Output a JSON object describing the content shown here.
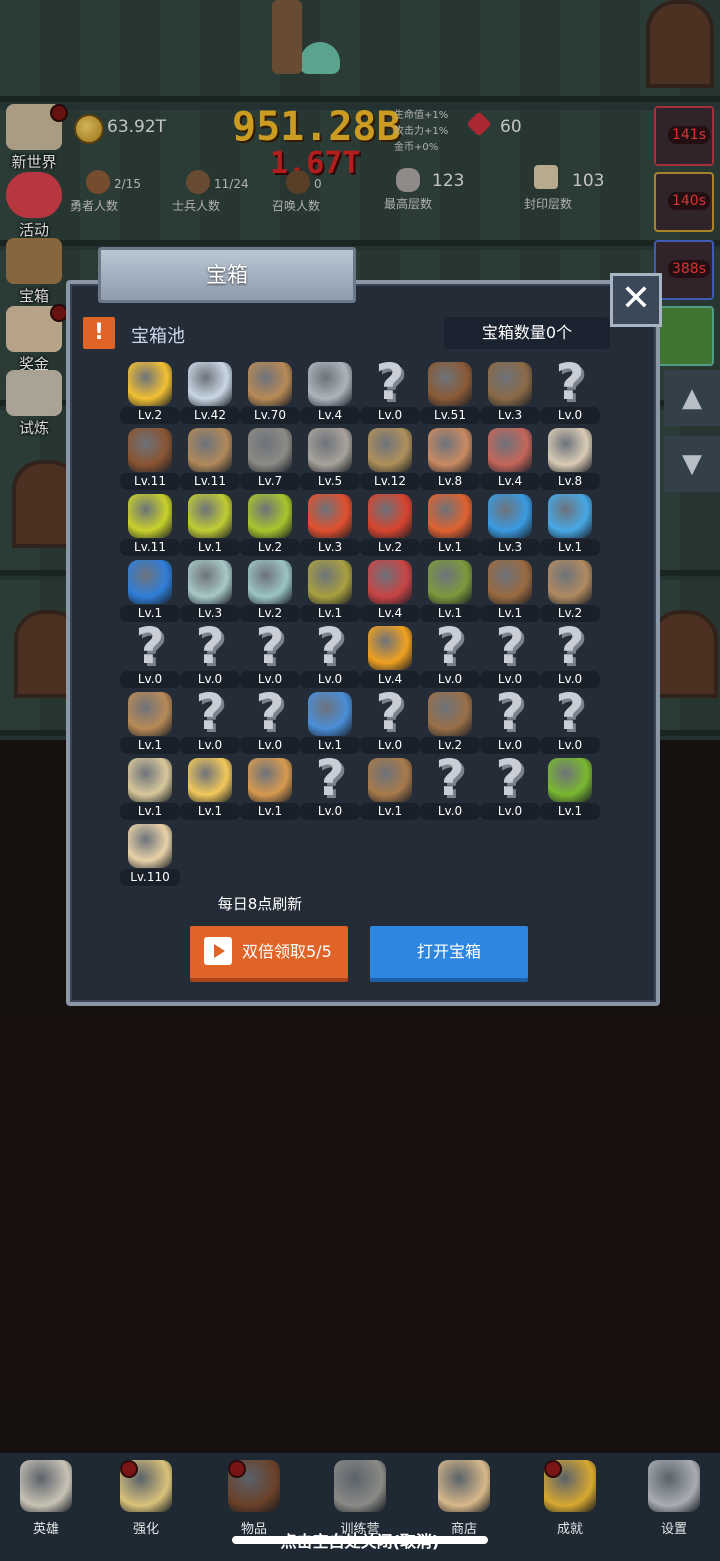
{
  "hud": {
    "gold": "63.92T",
    "gems": "60",
    "buffs": [
      "生命值+1%",
      "攻击力+1%",
      "金币+0%"
    ],
    "damage_main": "951.28B",
    "damage_sub": "1.67T",
    "stats": [
      {
        "value": "2/15",
        "label": "勇者人数"
      },
      {
        "value": "11/24",
        "label": "士兵人数"
      },
      {
        "value": "0",
        "label": "召唤人数"
      },
      {
        "value": "123",
        "label": "最高层数"
      },
      {
        "value": "103",
        "label": "封印层数"
      }
    ]
  },
  "sidebar": {
    "items": [
      {
        "label": "新世界"
      },
      {
        "label": "活动"
      },
      {
        "label": "宝箱"
      },
      {
        "label": "奖金"
      },
      {
        "label": "试炼"
      }
    ]
  },
  "timers": [
    "141s",
    "140s",
    "388s"
  ],
  "modal": {
    "title": "宝箱",
    "pool_label": "宝箱池",
    "warn_glyph": "!",
    "close_glyph": "✕",
    "chest_count": "宝箱数量0个",
    "refresh_text": "每日8点刷新",
    "double_button": "双倍领取5/5",
    "open_button": "打开宝箱",
    "items": [
      {
        "icon": "crown-icon",
        "lv": "Lv.2",
        "color": "#f2c033"
      },
      {
        "icon": "diamond-icon",
        "lv": "Lv.42",
        "color": "#c9d7e4"
      },
      {
        "icon": "wooden-sword-icon",
        "lv": "Lv.70",
        "color": "#b88a56"
      },
      {
        "icon": "steel-sword-icon",
        "lv": "Lv.4",
        "color": "#aeb4bc"
      },
      {
        "icon": "unknown-icon",
        "lv": "Lv.0",
        "color": "#c9ced6"
      },
      {
        "icon": "leather-armor-icon",
        "lv": "Lv.51",
        "color": "#8a5a36"
      },
      {
        "icon": "backpack-icon",
        "lv": "Lv.3",
        "color": "#8a6a46"
      },
      {
        "icon": "unknown-icon",
        "lv": "Lv.0",
        "color": "#c9ced6"
      },
      {
        "icon": "leather-helmet-icon",
        "lv": "Lv.11",
        "color": "#8a5432"
      },
      {
        "icon": "dagger-icon",
        "lv": "Lv.11",
        "color": "#b0895a"
      },
      {
        "icon": "iron-helmet-icon",
        "lv": "Lv.7",
        "color": "#8c8a84"
      },
      {
        "icon": "hammer-icon",
        "lv": "Lv.5",
        "color": "#a8a29a"
      },
      {
        "icon": "knight-helmet-icon",
        "lv": "Lv.12",
        "color": "#b0905a"
      },
      {
        "icon": "ham-icon",
        "lv": "Lv.8",
        "color": "#c98a62"
      },
      {
        "icon": "steak-icon",
        "lv": "Lv.4",
        "color": "#c4665a"
      },
      {
        "icon": "rice-bowl-icon",
        "lv": "Lv.8",
        "color": "#d9cbb5"
      },
      {
        "icon": "yellow-potion-icon",
        "lv": "Lv.11",
        "color": "#c8d12a"
      },
      {
        "icon": "yellow-potion-small-icon",
        "lv": "Lv.1",
        "color": "#c0cc33"
      },
      {
        "icon": "green-potion-icon",
        "lv": "Lv.2",
        "color": "#a9c52c"
      },
      {
        "icon": "red-potion-icon",
        "lv": "Lv.3",
        "color": "#e0502e"
      },
      {
        "icon": "red-flask-icon",
        "lv": "Lv.2",
        "color": "#d8442e"
      },
      {
        "icon": "orange-potion-icon",
        "lv": "Lv.1",
        "color": "#e06230"
      },
      {
        "icon": "blue-potion-icon",
        "lv": "Lv.3",
        "color": "#3a9ae0"
      },
      {
        "icon": "blue-flask-icon",
        "lv": "Lv.1",
        "color": "#47a8e6"
      },
      {
        "icon": "mana-potion-icon",
        "lv": "Lv.1",
        "color": "#2f7ed8"
      },
      {
        "icon": "water-bottle-icon",
        "lv": "Lv.3",
        "color": "#a8c8c8"
      },
      {
        "icon": "water-bottle-2-icon",
        "lv": "Lv.2",
        "color": "#9cc4c4"
      },
      {
        "icon": "wine-bottle-icon",
        "lv": "Lv.1",
        "color": "#a8a040"
      },
      {
        "icon": "red-vial-icon",
        "lv": "Lv.4",
        "color": "#c84444"
      },
      {
        "icon": "winged-boots-icon",
        "lv": "Lv.1",
        "color": "#7c9a3c"
      },
      {
        "icon": "leather-boots-icon",
        "lv": "Lv.1",
        "color": "#9a6a40"
      },
      {
        "icon": "travel-boots-icon",
        "lv": "Lv.2",
        "color": "#b08a60"
      },
      {
        "icon": "unknown-icon",
        "lv": "Lv.0",
        "color": "#c9ced6"
      },
      {
        "icon": "unknown-icon",
        "lv": "Lv.0",
        "color": "#c9ced6"
      },
      {
        "icon": "unknown-icon",
        "lv": "Lv.0",
        "color": "#c9ced6"
      },
      {
        "icon": "unknown-icon",
        "lv": "Lv.0",
        "color": "#c9ced6"
      },
      {
        "icon": "torch-icon",
        "lv": "Lv.4",
        "color": "#f0a020"
      },
      {
        "icon": "unknown-icon",
        "lv": "Lv.0",
        "color": "#c9ced6"
      },
      {
        "icon": "unknown-icon",
        "lv": "Lv.0",
        "color": "#c9ced6"
      },
      {
        "icon": "unknown-icon",
        "lv": "Lv.0",
        "color": "#c9ced6"
      },
      {
        "icon": "wooden-staff-icon",
        "lv": "Lv.1",
        "color": "#b88a56"
      },
      {
        "icon": "unknown-icon",
        "lv": "Lv.0",
        "color": "#c9ced6"
      },
      {
        "icon": "unknown-icon",
        "lv": "Lv.0",
        "color": "#c9ced6"
      },
      {
        "icon": "blue-wand-icon",
        "lv": "Lv.1",
        "color": "#4a8ed8"
      },
      {
        "icon": "unknown-icon",
        "lv": "Lv.0",
        "color": "#c9ced6"
      },
      {
        "icon": "large-backpack-icon",
        "lv": "Lv.2",
        "color": "#9a7048"
      },
      {
        "icon": "unknown-icon",
        "lv": "Lv.0",
        "color": "#c9ced6"
      },
      {
        "icon": "unknown-icon",
        "lv": "Lv.0",
        "color": "#c9ced6"
      },
      {
        "icon": "bone-club-icon",
        "lv": "Lv.1",
        "color": "#d8c89a"
      },
      {
        "icon": "cheese-icon",
        "lv": "Lv.1",
        "color": "#f2c85a"
      },
      {
        "icon": "pie-icon",
        "lv": "Lv.1",
        "color": "#d89a50"
      },
      {
        "icon": "unknown-icon",
        "lv": "Lv.0",
        "color": "#c9ced6"
      },
      {
        "icon": "bow-icon",
        "lv": "Lv.1",
        "color": "#a87a4a"
      },
      {
        "icon": "unknown-icon",
        "lv": "Lv.0",
        "color": "#c9ced6"
      },
      {
        "icon": "unknown-icon",
        "lv": "Lv.0",
        "color": "#c9ced6"
      },
      {
        "icon": "green-scepter-icon",
        "lv": "Lv.1",
        "color": "#7ab830"
      },
      {
        "icon": "beer-mug-icon",
        "lv": "Lv.110",
        "color": "#e8d2a8"
      }
    ]
  },
  "bottom_nav": {
    "items": [
      {
        "label": "英雄",
        "icon": "skull-icon",
        "color": "#c9c3b5",
        "dot": false
      },
      {
        "label": "强化",
        "icon": "candle-icon",
        "color": "#d9c27a",
        "dot": true
      },
      {
        "label": "物品",
        "icon": "book-icon",
        "color": "#6a4028",
        "dot": true
      },
      {
        "label": "训练营",
        "icon": "lantern-icon",
        "color": "#8a8a86",
        "dot": false
      },
      {
        "label": "商店",
        "icon": "beer-mug-icon",
        "color": "#d8b88a",
        "dot": false
      },
      {
        "label": "成就",
        "icon": "key-icon",
        "color": "#d8a830",
        "dot": true
      },
      {
        "label": "设置",
        "icon": "gear-icon",
        "color": "#a9adb3",
        "dot": false
      }
    ],
    "hint": "点击空白处关闭(取消)"
  }
}
